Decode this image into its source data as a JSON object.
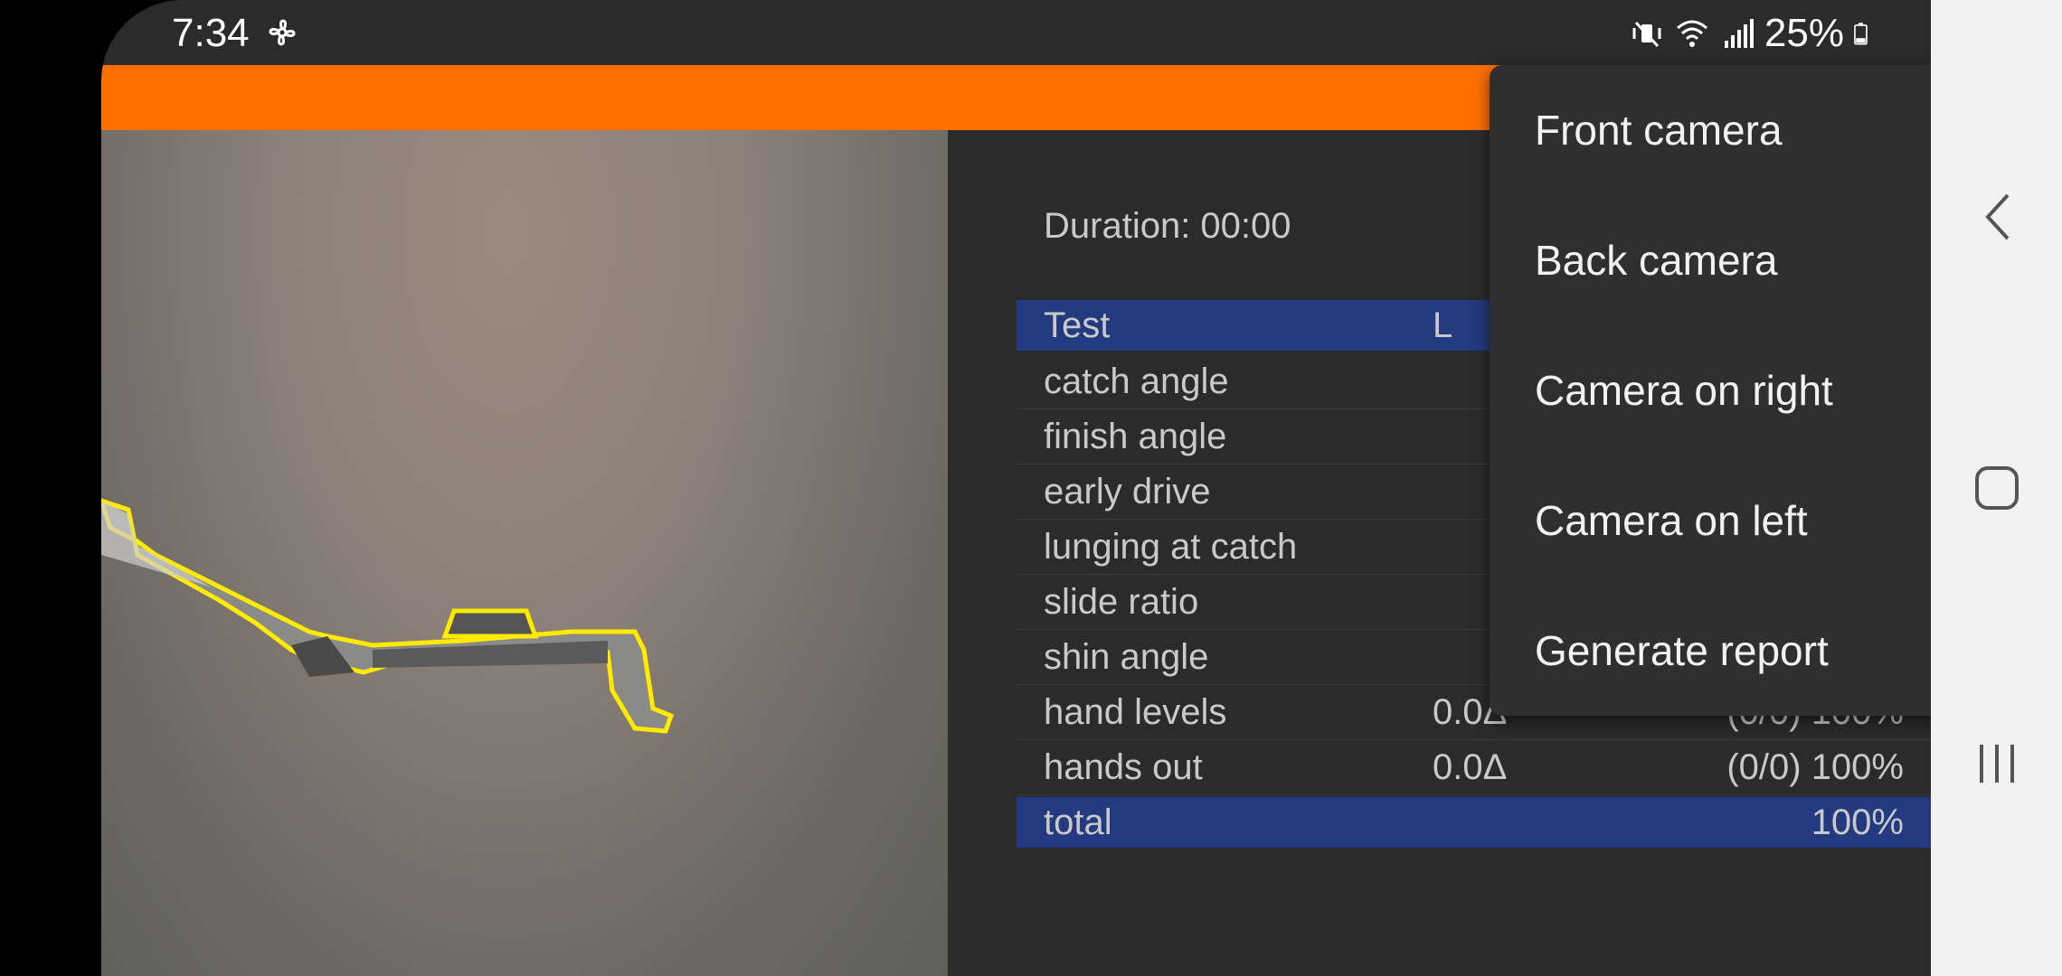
{
  "status": {
    "time": "7:34",
    "battery": "25%",
    "icons": [
      "fan-icon",
      "mute-icon",
      "wifi-icon",
      "signal-icon",
      "battery-icon"
    ]
  },
  "colors": {
    "appbar": "#ff6f00",
    "table_header": "#233a80",
    "background": "#2b2b2b"
  },
  "session": {
    "duration": "Duration: 00:00"
  },
  "table": {
    "header": {
      "c1": "Test",
      "c2": "L",
      "c3": ""
    },
    "rows": [
      {
        "c1": "catch angle",
        "c2": "",
        "c3": ""
      },
      {
        "c1": "finish angle",
        "c2": "",
        "c3": ""
      },
      {
        "c1": "early drive",
        "c2": "",
        "c3": ""
      },
      {
        "c1": "lunging at catch",
        "c2": "",
        "c3": ""
      },
      {
        "c1": "slide ratio",
        "c2": "",
        "c3": ""
      },
      {
        "c1": "shin angle",
        "c2": "",
        "c3": ""
      },
      {
        "c1": "hand levels",
        "c2": "0.0Δ",
        "c3": "(0/0) 100%"
      },
      {
        "c1": "hands out",
        "c2": "0.0Δ",
        "c3": "(0/0) 100%"
      }
    ],
    "total": {
      "c1": "total",
      "c3": "100%"
    }
  },
  "menu": {
    "items": [
      "Front camera",
      "Back camera",
      "Camera on right",
      "Camera on left",
      "Generate report"
    ]
  },
  "navbar": {
    "icons": [
      "back-icon",
      "home-icon",
      "recents-icon"
    ]
  }
}
